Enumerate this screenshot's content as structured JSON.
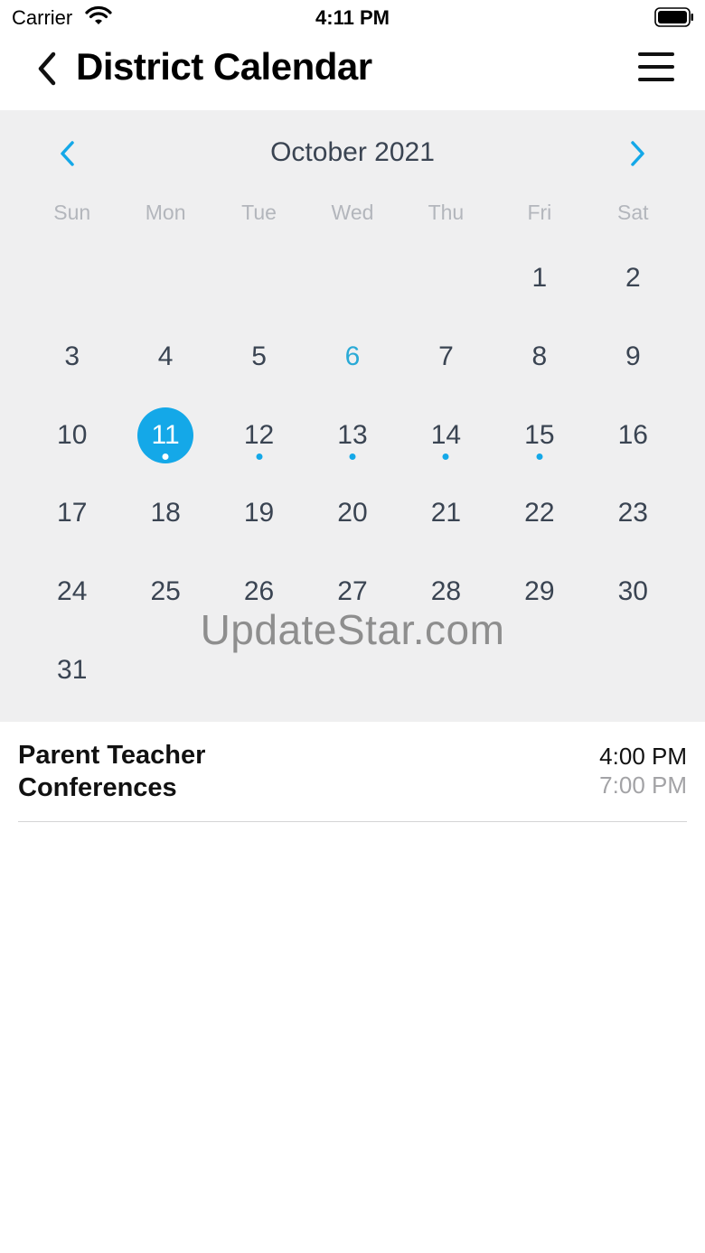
{
  "status_bar": {
    "carrier": "Carrier",
    "time": "4:11 PM"
  },
  "header": {
    "title": "District Calendar",
    "back_icon": "chevron-left-icon",
    "menu_icon": "hamburger-menu-icon"
  },
  "calendar": {
    "month_label": "October 2021",
    "prev_icon": "chevron-left-icon",
    "next_icon": "chevron-right-icon",
    "accent_color": "#14a8e8",
    "today_color": "#2aaad6",
    "weekdays": [
      "Sun",
      "Mon",
      "Tue",
      "Wed",
      "Thu",
      "Fri",
      "Sat"
    ],
    "leading_blank_days": 5,
    "days": [
      "1",
      "2",
      "3",
      "4",
      "5",
      "6",
      "7",
      "8",
      "9",
      "10",
      "11",
      "12",
      "13",
      "14",
      "15",
      "16",
      "17",
      "18",
      "19",
      "20",
      "21",
      "22",
      "23",
      "24",
      "25",
      "26",
      "27",
      "28",
      "29",
      "30",
      "31"
    ],
    "today": "6",
    "selected": "11",
    "event_days": [
      "11",
      "12",
      "13",
      "14",
      "15"
    ]
  },
  "watermark": "UpdateStar.com",
  "events": [
    {
      "title": "Parent Teacher Conferences",
      "start": "4:00 PM",
      "end": "7:00 PM"
    }
  ]
}
